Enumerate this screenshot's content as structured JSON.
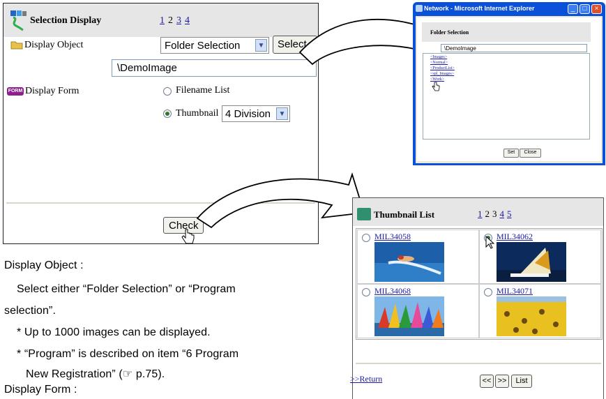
{
  "selection_panel": {
    "title": "Selection Display",
    "pages": [
      "1",
      "2",
      "3",
      "4"
    ],
    "display_object_label": "Display Object",
    "folder_select_value": "Folder Selection",
    "select_button": "Select",
    "path_value": "\\DemoImage",
    "display_form_label": "Display Form",
    "form_icon_text": "FORM",
    "option_filename_list": "Filename List",
    "option_thumbnail": "Thumbnail",
    "division_value": "4 Division",
    "check_button": "Check"
  },
  "folder_window": {
    "title": "Network - Microsoft Internet Explorer",
    "header": "Folder Selection",
    "path": "\\DemoImage",
    "tree_items": [
      "<Images>",
      "<Normal>",
      "<ProductList>",
      "<spl_Images>",
      "<Work>"
    ],
    "set_button": "Set",
    "close_button": "Close"
  },
  "thumbnail_list": {
    "title": "Thumbnail List",
    "pages": [
      "1",
      "2",
      "3",
      "4",
      "5"
    ],
    "items": [
      {
        "name": "MIL34058",
        "selected": false
      },
      {
        "name": "MIL34062",
        "selected": true
      },
      {
        "name": "MIL34068",
        "selected": false
      },
      {
        "name": "MIL34071",
        "selected": false
      }
    ],
    "return_link": ">>Return",
    "prev_button": "<<",
    "next_button": ">>",
    "list_button": "List"
  },
  "body_text": {
    "heading_object": "Display Object :",
    "desc_line1": "Select either “Folder Selection” or “Program",
    "desc_line2": "selection”.",
    "note1": "* Up to 1000 images can be displayed.",
    "note2_line1": "* “Program” is described on item “6 Program",
    "note2_line2": "New Registration” (☞ p.75).",
    "heading_form": "Display Form :"
  },
  "colors": {
    "header_bg": "#e6e6e6",
    "link": "#1a1aa6",
    "ie_titlebar": "#0a50d8"
  }
}
